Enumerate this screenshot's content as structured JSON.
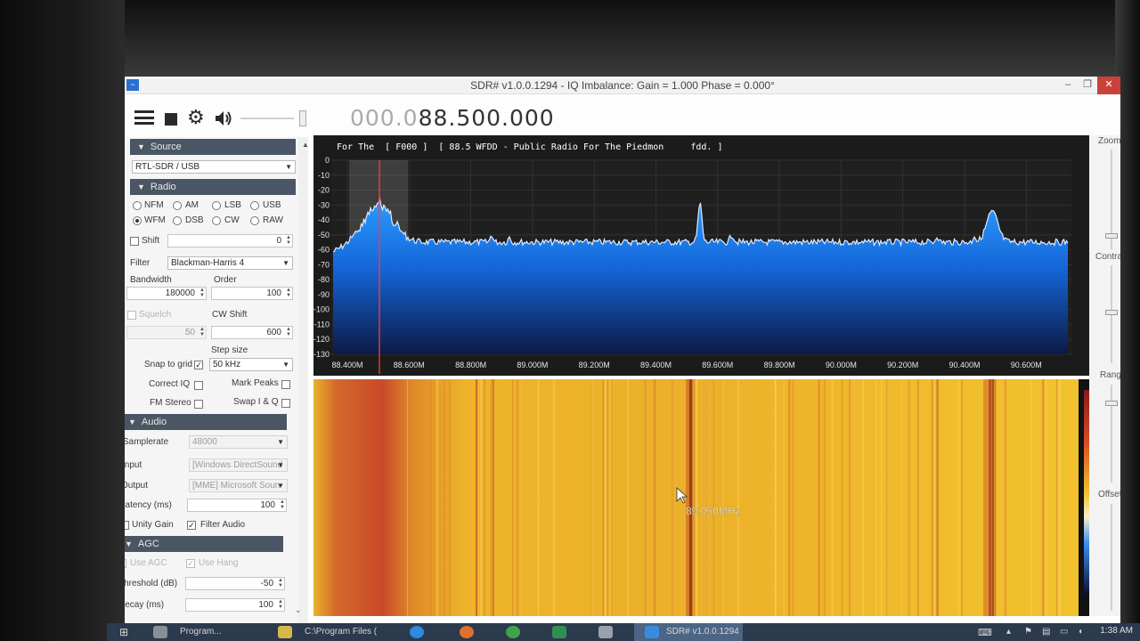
{
  "window": {
    "title": "SDR# v1.0.0.1294 - IQ Imbalance: Gain = 1.000 Phase = 0.000°",
    "controls": [
      "–",
      "❐",
      "✕"
    ]
  },
  "toolbar": {
    "menu_icon": "hamburger-menu-icon",
    "stop_icon": "stop-icon",
    "settings_icon": "gear-icon",
    "audio_icon": "speaker-icon",
    "frequency_dim": "000.0",
    "frequency_main": "88.500.000"
  },
  "sections": {
    "source": {
      "title": "Source",
      "device": "RTL-SDR / USB"
    },
    "radio": {
      "title": "Radio",
      "modes": [
        {
          "label": "NFM",
          "selected": false
        },
        {
          "label": "AM",
          "selected": false
        },
        {
          "label": "LSB",
          "selected": false
        },
        {
          "label": "USB",
          "selected": false
        },
        {
          "label": "WFM",
          "selected": true
        },
        {
          "label": "DSB",
          "selected": false
        },
        {
          "label": "CW",
          "selected": false
        },
        {
          "label": "RAW",
          "selected": false
        }
      ],
      "shift_label": "Shift",
      "shift_value": "0",
      "filter_label": "Filter",
      "filter_value": "Blackman-Harris 4",
      "bandwidth_label": "Bandwidth",
      "bandwidth_value": "180000",
      "order_label": "Order",
      "order_value": "100",
      "squelch_label": "Squelch",
      "squelch_value": "50",
      "cw_shift_label": "CW Shift",
      "cw_shift_value": "600",
      "step_size_label": "Step size",
      "snap_label": "Snap to grid",
      "snap_checked": "✓",
      "step_value": "50 kHz",
      "correct_iq_label": "Correct IQ",
      "mark_peaks_label": "Mark Peaks",
      "fm_stereo_label": "FM Stereo",
      "swap_iq_label": "Swap I & Q"
    },
    "audio": {
      "title": "Audio",
      "samplerate_label": "Samplerate",
      "samplerate_value": "48000",
      "input_label": "Input",
      "input_value": "[Windows DirectSound",
      "output_label": "Output",
      "output_value": "[MME] Microsoft Soun",
      "latency_label": "Latency (ms)",
      "latency_value": "100",
      "unity_gain_label": "Unity Gain",
      "filter_audio_label": "Filter Audio",
      "filter_audio_checked": "✓"
    },
    "agc": {
      "title": "AGC",
      "use_agc_label": "Use AGC",
      "use_hang_label": "Use Hang",
      "use_hang_checked": "✓",
      "threshold_label": "Threshold (dB)",
      "threshold_value": "-50",
      "decay_label": "Decay (ms)",
      "decay_value": "100"
    }
  },
  "spectrum": {
    "rds_text": "For The  [ F000 ]  [ 88.5 WFDD - Public Radio For The Piedmon     fdd. ]",
    "y_ticks": [
      "0",
      "-10",
      "-20",
      "-30",
      "-40",
      "-50",
      "-60",
      "-70",
      "-80",
      "-90",
      "-100",
      "-110",
      "-120",
      "-130"
    ],
    "x_ticks": [
      "88.400M",
      "88.600M",
      "88.800M",
      "89.000M",
      "89.200M",
      "89.400M",
      "89.600M",
      "89.800M",
      "90.000M",
      "90.200M",
      "90.400M",
      "90.600M"
    ],
    "colors": {
      "fill_top": "#1e90ff",
      "fill_bottom": "#0a1a4a",
      "trace": "#dfe9ff",
      "grid": "#3a3a3a",
      "tuning_line": "#ff3b3b"
    }
  },
  "waterfall": {
    "cursor_readout": "89.050MHz",
    "colors": {
      "base": "#e8ad28",
      "hot": "#c4492a",
      "bright": "#f6d13a"
    }
  },
  "right_panel": {
    "zoom_label": "Zoom",
    "contrast_label": "Contrast",
    "range_label": "Range",
    "offset_label": "Offset"
  },
  "taskbar": {
    "items": [
      "Program...",
      "C:\\Program Files (",
      "SDR# v1.0.0.1294"
    ],
    "clock": "1:38 AM"
  }
}
